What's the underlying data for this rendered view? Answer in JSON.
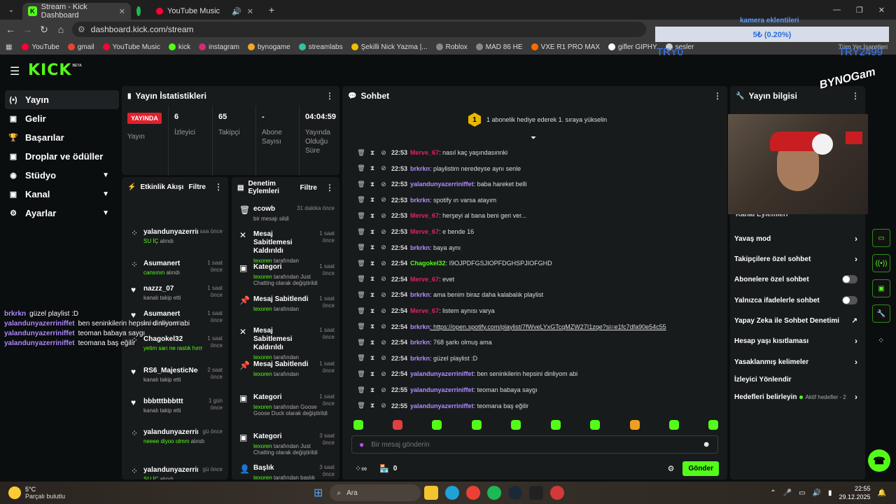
{
  "browser": {
    "tabs": [
      {
        "title": "Stream - Kick Dashboard",
        "fav": "K",
        "color": "#53fc18"
      },
      {
        "title": "",
        "fav": "",
        "color": "#1db954"
      },
      {
        "title": "YouTube Music",
        "fav": "",
        "color": "#ff0033"
      }
    ],
    "url": "dashboard.kick.com/stream",
    "new_tab": "+",
    "bookmarks": [
      {
        "label": "YouTube",
        "color": "#ff0033"
      },
      {
        "label": "gmail",
        "color": "#ea4335"
      },
      {
        "label": "YouTube Music",
        "color": "#ff0033"
      },
      {
        "label": "kick",
        "color": "#53fc18"
      },
      {
        "label": "instagram",
        "color": "#d62976"
      },
      {
        "label": "bynogame",
        "color": "#f5a623"
      },
      {
        "label": "streamlabs",
        "color": "#31c3a2"
      },
      {
        "label": "Şekilli Nick Yazma |...",
        "color": "#f0c000"
      },
      {
        "label": "Roblox",
        "color": "#888888"
      },
      {
        "label": "MAD 86 HE",
        "color": "#888888"
      },
      {
        "label": "VXE R1 PRO MAX",
        "color": "#ff6a00"
      },
      {
        "label": "gifler GIPHY",
        "color": "#ffffff"
      },
      {
        "label": "sesler",
        "color": "#cccccc"
      }
    ],
    "bookmarks_right": "Tüm Yer İşaretleri"
  },
  "kick": {
    "logo": "KICK",
    "logo_sup": "BETA",
    "sidebar": [
      {
        "label": "Yayın",
        "icon": "(•)",
        "chev": false,
        "active": true
      },
      {
        "label": "Gelir",
        "icon": "▣",
        "chev": false
      },
      {
        "label": "Başarılar",
        "icon": "🏆",
        "chev": false
      },
      {
        "label": "Droplar ve ödüller",
        "icon": "▣",
        "chev": false
      },
      {
        "label": "Stüdyo",
        "icon": "◉",
        "chev": true
      },
      {
        "label": "Kanal",
        "icon": "▣",
        "chev": true
      },
      {
        "label": "Ayarlar",
        "icon": "⚙",
        "chev": true
      }
    ],
    "stats": {
      "title": "Yayın İstatistikleri",
      "live": "YAYINDA",
      "live_label": "Yayın",
      "items": [
        {
          "value": "6",
          "label": "İzleyici"
        },
        {
          "value": "65",
          "label": "Takipçi"
        },
        {
          "value": "-",
          "label": "Abone Sayısı"
        },
        {
          "value": "04:04:59",
          "label": "Yayında Olduğu Süre"
        }
      ]
    },
    "activity": {
      "title": "Etkinlik Akışı",
      "filter": "Filtre",
      "items": [
        {
          "name": "yalandunyazerriniffet",
          "time": "saa önce",
          "sub_g": "SU İÇ",
          "sub": " alındı"
        },
        {
          "name": "Asumanert",
          "time": "1 saat önce",
          "sub_g": "cansının",
          "sub": " alındı"
        },
        {
          "name": "nazzz_07",
          "time": "1 saat önce",
          "sub_g": "",
          "sub": "kanalı takip etti"
        },
        {
          "name": "Asumanert",
          "time": "1 saat önce",
          "sub_g": "",
          "sub": "kanalı takip etti"
        },
        {
          "name": "Chagokel32",
          "time": "1 saat önce",
          "sub_g": "yetim sarı ne rastık hırrr",
          "sub": ""
        },
        {
          "name": "RS6_MajesticNeon",
          "time": "2 saat önce",
          "sub_g": "",
          "sub": "kanalı takip etti"
        },
        {
          "name": "bbbtttbbbttt",
          "time": "1 gün önce",
          "sub_g": "",
          "sub": "kanalı takip etti"
        },
        {
          "name": "yalandunyazerriniffet",
          "time": "gü önce",
          "sub_g": "neeee diyoo olmm",
          "sub": " alındı"
        },
        {
          "name": "yalandunyazerriniffet",
          "time": "gü önce",
          "sub_g": "SU İÇ",
          "sub": " alındı"
        }
      ]
    },
    "moderation": {
      "title": "Denetim Eylemleri",
      "filter": "Filtre",
      "items": [
        {
          "name": "ecowb",
          "time": "31 dakika önce",
          "sub_g": "",
          "sub": "bir mesajı sildi",
          "icon": "🗑"
        },
        {
          "name": "Mesaj Sabitlemesi Kaldırıldı",
          "time": "1 saat önce",
          "sub_g": "texoren",
          "sub": " tarafından",
          "icon": "✕"
        },
        {
          "name": "Kategori",
          "time": "1 saat önce",
          "sub_g": "texoren",
          "sub": " tarafından Just Chatting olarak değiştirildi",
          "icon": "▣"
        },
        {
          "name": "Mesaj Sabitlendi",
          "time": "1 saat önce",
          "sub_g": "texoren",
          "sub": " tarafından",
          "icon": "📌"
        },
        {
          "name": "Mesaj Sabitlemesi Kaldırıldı",
          "time": "1 saat önce",
          "sub_g": "texoren",
          "sub": " tarafından",
          "icon": "✕"
        },
        {
          "name": "Mesaj Sabitlendi",
          "time": "1 saat önce",
          "sub_g": "texoren",
          "sub": " tarafından",
          "icon": "📌"
        },
        {
          "name": "Kategori",
          "time": "1 saat önce",
          "sub_g": "texoren",
          "sub": " tarafından Goose Goose Duck olarak değiştirildi",
          "icon": "▣"
        },
        {
          "name": "Kategori",
          "time": "3 saat önce",
          "sub_g": "texoren",
          "sub": " tarafından Just Chatting olarak değiştirildi",
          "icon": "▣"
        },
        {
          "name": "Başlık",
          "time": "3 saat önce",
          "sub_g": "texoren",
          "sub": " tarafından başlık",
          "icon": "👤"
        }
      ]
    },
    "chat": {
      "title": "Sohbet",
      "gift_banner": "1 abonelik hediye ederek 1. sıraya yükselin",
      "gift_rank": "1",
      "messages": [
        {
          "time": "22:53",
          "user": "Merve_67",
          "color": "#e0245e",
          "text": ": nasıl kaç yaşındasınnki"
        },
        {
          "time": "22:53",
          "user": "brkrkn",
          "color": "#b18cff",
          "text": ": playlistim neredeyse aynı senle"
        },
        {
          "time": "22:53",
          "user": "yalandunyazerriniffet",
          "color": "#b18cff",
          "text": ": baba hareket belli"
        },
        {
          "time": "22:53",
          "user": "brkrkn",
          "color": "#b18cff",
          "text": ": spotify ın varsa atayım"
        },
        {
          "time": "22:53",
          "user": "Merve_67",
          "color": "#e0245e",
          "text": ": herşeyi al bana beni geri ver..."
        },
        {
          "time": "22:53",
          "user": "Merve_67",
          "color": "#e0245e",
          "text": ": e bende 16"
        },
        {
          "time": "22:54",
          "user": "brkrkn",
          "color": "#b18cff",
          "text": ": baya aynı"
        },
        {
          "time": "22:54",
          "user": "Chagokel32",
          "color": "#53fc18",
          "text": ": I9OJPDFGSJIOPFDGHSPJIOFGHD"
        },
        {
          "time": "22:54",
          "user": "Merve_67",
          "color": "#e0245e",
          "text": ": evet"
        },
        {
          "time": "22:54",
          "user": "brkrkn",
          "color": "#b18cff",
          "text": ": ama benim biraz daha kalabalık playlist"
        },
        {
          "time": "22:54",
          "user": "Merve_67",
          "color": "#e0245e",
          "text": ": listem aynısı varya"
        },
        {
          "time": "22:54",
          "user": "brkrkn",
          "color": "#b18cff",
          "text": ": https://open.spotify.com/playlist/7fWveLYxGTcqMZW27I1zqe?si=e1fc7dfa90e54c55"
        },
        {
          "time": "22:54",
          "user": "brkrkn",
          "color": "#b18cff",
          "text": ": 768 şarkı olmuş ama"
        },
        {
          "time": "22:54",
          "user": "brkrkn",
          "color": "#b18cff",
          "text": ": güzel playlist :D"
        },
        {
          "time": "22:54",
          "user": "yalandunyazerriniffet",
          "color": "#b18cff",
          "text": ": ben seninkilerin hepsini dinliyom abi"
        },
        {
          "time": "22:55",
          "user": "yalandunyazerriniffet",
          "color": "#b18cff",
          "text": ": teoman babaya saygı"
        },
        {
          "time": "22:55",
          "user": "yalandunyazerriniffet",
          "color": "#b18cff",
          "text": ": teomana baş eğilir"
        }
      ],
      "placeholder": "Bir mesaj gönderin",
      "viewer_count": "0",
      "send": "Gönder"
    },
    "info": {
      "title": "Yayın bilgisi",
      "items_partial": "Kanal Eylemleri",
      "items": [
        {
          "label": "Yavaş mod",
          "ctrl": "chev"
        },
        {
          "label": "Takipçilere özel sohbet",
          "ctrl": "chev"
        },
        {
          "label": "Abonelere özel sohbet",
          "ctrl": "toggle"
        },
        {
          "label": "Yalnızca ifadelerle sohbet",
          "ctrl": "toggle"
        },
        {
          "label": "Yapay Zeka ile Sohbet Denetimi",
          "ctrl": "ext"
        },
        {
          "label": "Hesap yaşı kısıtlaması",
          "ctrl": "chev"
        },
        {
          "label": "Yasaklanmış kelimeler",
          "ctrl": "chev"
        },
        {
          "label": "İzleyici Yönlendir",
          "ctrl": "none"
        },
        {
          "label": "Hedefleri belirleyin",
          "ctrl": "chev"
        }
      ],
      "goal_status": "Aktif hedefler - 2"
    }
  },
  "overlay": {
    "top_label": "kamera eklentileri",
    "goal_bar": "5₺ (0.20%)",
    "left_code": "TRY0",
    "right_code": "TRY2499",
    "brand": "BYNOGam",
    "chat_overlay": [
      {
        "user": "brkrkn",
        "text": "güzel playlist :D"
      },
      {
        "user": "yalandunyazerriniffet",
        "text": "ben seninkilerin hepsini dinliyom abi"
      },
      {
        "user": "yalandunyazerriniffet",
        "text": "teoman babaya saygı"
      },
      {
        "user": "yalandunyazerriniffet",
        "text": "teomana baş eğilir"
      }
    ]
  },
  "taskbar": {
    "temp": "5°C",
    "weather": "Parçalı bulutlu",
    "search": "Ara",
    "time": "22:55",
    "date": "29.12.2025"
  }
}
